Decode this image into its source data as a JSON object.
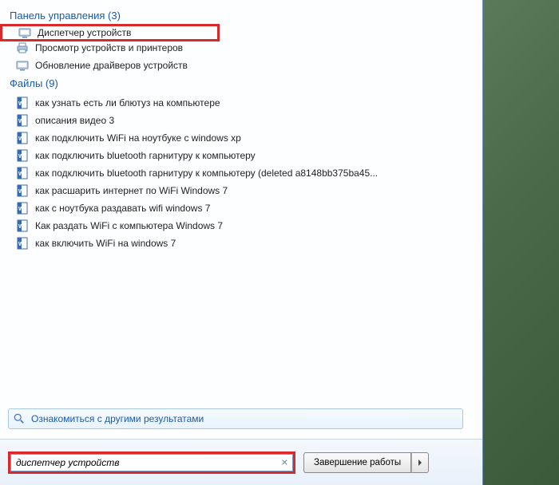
{
  "sections": {
    "control_panel": {
      "header": "Панель управления (3)",
      "items": [
        {
          "label": "Диспетчер устройств",
          "icon": "device-manager",
          "highlighted": true
        },
        {
          "label": "Просмотр устройств и принтеров",
          "icon": "printer"
        },
        {
          "label": "Обновление драйверов устройств",
          "icon": "device-manager"
        }
      ]
    },
    "files": {
      "header": "Файлы (9)",
      "items": [
        {
          "label": "как узнать есть ли блютуз на компьютере",
          "icon": "word"
        },
        {
          "label": "описания видео 3",
          "icon": "word"
        },
        {
          "label": "как подключить WiFi на ноутбуке с windows xp",
          "icon": "word"
        },
        {
          "label": "как подключить bluetooth гарнитуру к компьютеру",
          "icon": "word"
        },
        {
          "label": "как подключить bluetooth гарнитуру к компьютеру (deleted a8148bb375ba45...",
          "icon": "word"
        },
        {
          "label": "как расшарить интернет по WiFi Windows 7",
          "icon": "word"
        },
        {
          "label": "как с ноутбука раздавать wifi windows 7",
          "icon": "word"
        },
        {
          "label": "Как раздать WiFi с компьютера Windows 7",
          "icon": "word"
        },
        {
          "label": "как включить WiFi на windows 7",
          "icon": "word"
        }
      ]
    }
  },
  "see_more": {
    "label": "Ознакомиться с другими результатами"
  },
  "search": {
    "value": "диспетчер устройств"
  },
  "shutdown": {
    "label": "Завершение работы"
  }
}
